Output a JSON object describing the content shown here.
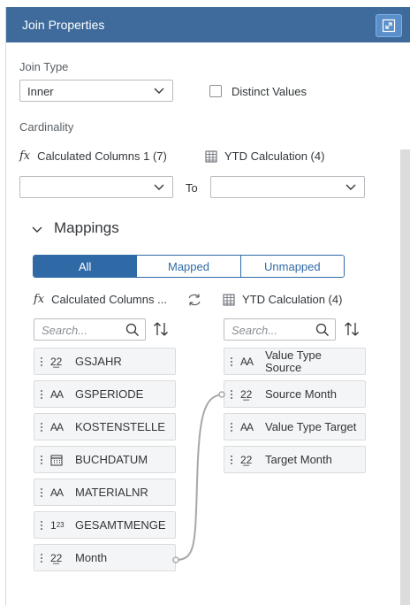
{
  "panel": {
    "title": "Join Properties"
  },
  "join_type": {
    "label": "Join Type",
    "value": "Inner"
  },
  "distinct": {
    "label": "Distinct Values",
    "checked": false
  },
  "cardinality": {
    "label": "Cardinality",
    "left_source": "Calculated Columns 1 (7)",
    "right_source": "YTD Calculation (4)",
    "to_label": "To",
    "left_value": "",
    "right_value": ""
  },
  "mappings": {
    "title": "Mappings",
    "segments": [
      "All",
      "Mapped",
      "Unmapped"
    ],
    "active_segment": "All",
    "left_header": "Calculated Columns ...",
    "right_header": "YTD Calculation (4)",
    "left_search_placeholder": "Search...",
    "right_search_placeholder": "Search...",
    "left_columns": [
      {
        "label": "GSJAHR",
        "type": "22"
      },
      {
        "label": "GSPERIODE",
        "type": "AA"
      },
      {
        "label": "KOSTENSTELLE",
        "type": "AA"
      },
      {
        "label": "BUCHDATUM",
        "type": "calendar"
      },
      {
        "label": "MATERIALNR",
        "type": "AA"
      },
      {
        "label": "GESAMTMENGE",
        "type": "123"
      },
      {
        "label": "Month",
        "type": "22"
      }
    ],
    "right_columns": [
      {
        "label": "Value Type Source",
        "type": "AA"
      },
      {
        "label": "Source Month",
        "type": "22"
      },
      {
        "label": "Value Type Target",
        "type": "AA"
      },
      {
        "label": "Target Month",
        "type": "22"
      }
    ],
    "connection": {
      "from": "Month",
      "to": "Source Month"
    }
  },
  "colors": {
    "header": "#3e6b9c",
    "accent": "#2f6aa6",
    "connector": "#a8a8a8"
  },
  "icons": {
    "expand": "expand-icon",
    "chevron": "chevron-down-icon",
    "fx": "formula-icon",
    "table": "table-icon",
    "swap": "swap-icon",
    "search": "search-icon",
    "sort": "sort-icon"
  }
}
